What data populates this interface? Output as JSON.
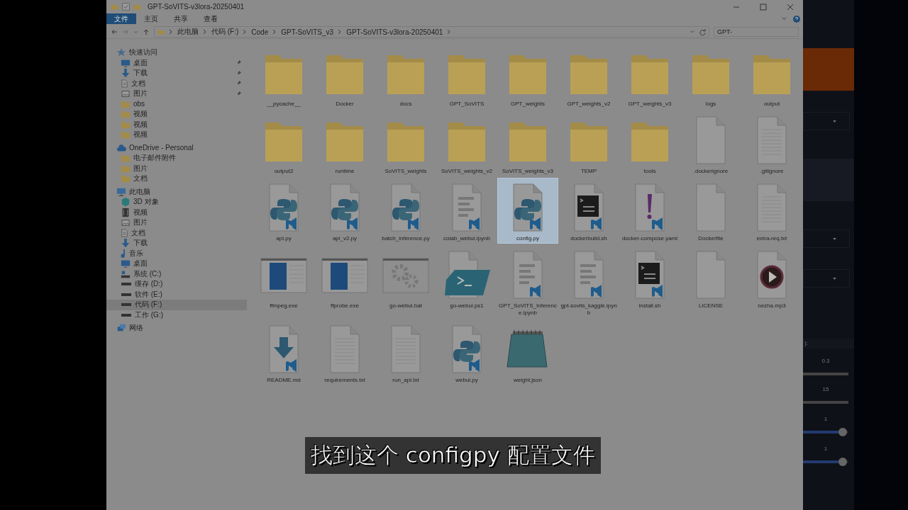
{
  "window": {
    "title": "GPT-SoVITS-v3lora-20250401"
  },
  "ribbon_tabs": [
    {
      "label": "文件",
      "selected": true
    },
    {
      "label": "主页",
      "selected": false
    },
    {
      "label": "共享",
      "selected": false
    },
    {
      "label": "查看",
      "selected": false
    }
  ],
  "address_bar": {
    "breadcrumbs": [
      "此电脑",
      "代码 (F:)",
      "Code",
      "GPT-SoVITS_v3",
      "GPT-SoVITS-v3lora-20250401"
    ],
    "search": {
      "placeholder": "GPT-"
    }
  },
  "nav": [
    {
      "kind": "star",
      "label": "快速访问",
      "selected": false,
      "children": [
        {
          "kind": "desktop",
          "label": "桌面",
          "selected": false,
          "pinned": true
        },
        {
          "kind": "download",
          "label": "下载",
          "selected": false,
          "pinned": true
        },
        {
          "kind": "document",
          "label": "文档",
          "selected": false,
          "pinned": true
        },
        {
          "kind": "picture",
          "label": "图片",
          "selected": false,
          "pinned": true
        },
        {
          "kind": "folder",
          "label": "obs",
          "selected": false,
          "pinned": false
        },
        {
          "kind": "folder",
          "label": "视频",
          "selected": false,
          "pinned": false
        },
        {
          "kind": "folder",
          "label": "视频",
          "selected": false,
          "pinned": false
        },
        {
          "kind": "folder",
          "label": "视频",
          "selected": false,
          "pinned": false
        }
      ]
    },
    {
      "kind": "cloud",
      "label": "OneDrive - Personal",
      "selected": false,
      "children": [
        {
          "kind": "folder",
          "label": "电子邮件附件",
          "selected": false
        },
        {
          "kind": "folder",
          "label": "图片",
          "selected": false
        },
        {
          "kind": "folder",
          "label": "文档",
          "selected": false
        }
      ]
    },
    {
      "kind": "computer",
      "label": "此电脑",
      "selected": false,
      "children": [
        {
          "kind": "cube",
          "label": "3D 对象",
          "selected": false
        },
        {
          "kind": "video",
          "label": "视频",
          "selected": false
        },
        {
          "kind": "picture",
          "label": "图片",
          "selected": false
        },
        {
          "kind": "document",
          "label": "文档",
          "selected": false
        },
        {
          "kind": "download",
          "label": "下载",
          "selected": false
        },
        {
          "kind": "music",
          "label": "音乐",
          "selected": false
        },
        {
          "kind": "desktop",
          "label": "桌面",
          "selected": false
        },
        {
          "kind": "system-drive",
          "label": "系统 (C:)",
          "selected": false
        },
        {
          "kind": "drive",
          "label": "缓存 (D:)",
          "selected": false
        },
        {
          "kind": "drive",
          "label": "软件 (E:)",
          "selected": false
        },
        {
          "kind": "drive",
          "label": "代码 (F:)",
          "selected": true
        },
        {
          "kind": "drive",
          "label": "工作 (G:)",
          "selected": false
        }
      ]
    },
    {
      "kind": "network",
      "label": "网络",
      "selected": false
    }
  ],
  "files": [
    {
      "kind": "folder",
      "name": "__pycache__",
      "selected": false
    },
    {
      "kind": "folder",
      "name": "Docker",
      "selected": false
    },
    {
      "kind": "folder",
      "name": "docs",
      "selected": false
    },
    {
      "kind": "folder",
      "name": "GPT_SoVITS",
      "selected": false
    },
    {
      "kind": "folder",
      "name": "GPT_weights",
      "selected": false
    },
    {
      "kind": "folder",
      "name": "GPT_weights_v2",
      "selected": false
    },
    {
      "kind": "folder",
      "name": "GPT_weights_v3",
      "selected": false
    },
    {
      "kind": "folder",
      "name": "logs",
      "selected": false
    },
    {
      "kind": "folder",
      "name": "output",
      "selected": false
    },
    {
      "kind": "folder",
      "name": "output2",
      "selected": false
    },
    {
      "kind": "folder",
      "name": "runtime",
      "selected": false
    },
    {
      "kind": "folder",
      "name": "SoVITS_weights",
      "selected": false
    },
    {
      "kind": "folder",
      "name": "SoVITS_weights_v2",
      "selected": false
    },
    {
      "kind": "folder",
      "name": "SoVITS_weights_v3",
      "selected": false
    },
    {
      "kind": "folder",
      "name": "TEMP",
      "selected": false
    },
    {
      "kind": "folder",
      "name": "tools",
      "selected": false
    },
    {
      "kind": "blank",
      "name": ".dockerignore",
      "selected": false
    },
    {
      "kind": "text",
      "name": ".gitignore",
      "selected": false
    },
    {
      "kind": "python",
      "name": "api.py",
      "selected": false
    },
    {
      "kind": "python",
      "name": "api_v2.py",
      "selected": false
    },
    {
      "kind": "python",
      "name": "batch_inference.py",
      "selected": false
    },
    {
      "kind": "notebook",
      "name": "colab_webui.ipynb",
      "selected": false
    },
    {
      "kind": "python",
      "name": "config.py",
      "selected": true
    },
    {
      "kind": "terminal",
      "name": "dockerbuild.sh",
      "selected": false
    },
    {
      "kind": "yaml",
      "name": "docker-compose.yaml",
      "selected": false
    },
    {
      "kind": "blank",
      "name": "Dockerfile",
      "selected": false
    },
    {
      "kind": "text",
      "name": "extra-req.txt",
      "selected": false
    },
    {
      "kind": "exe",
      "name": "ffmpeg.exe",
      "selected": false
    },
    {
      "kind": "exe",
      "name": "ffprobe.exe",
      "selected": false
    },
    {
      "kind": "bat",
      "name": "go-webui.bat",
      "selected": false
    },
    {
      "kind": "ps1",
      "name": "go-webui.ps1",
      "selected": false
    },
    {
      "kind": "notebook",
      "name": "GPT_SoVITS_Inference.ipynb",
      "selected": false
    },
    {
      "kind": "notebook",
      "name": "gpt-sovits_kaggle.ipynb",
      "selected": false
    },
    {
      "kind": "terminal",
      "name": "install.sh",
      "selected": false
    },
    {
      "kind": "blank",
      "name": "LICENSE",
      "selected": false
    },
    {
      "kind": "audio",
      "name": "nezha.mp3",
      "selected": false
    },
    {
      "kind": "markdown",
      "name": "README.md",
      "selected": false
    },
    {
      "kind": "text",
      "name": "requirements.txt",
      "selected": false
    },
    {
      "kind": "text",
      "name": "run_api.txt",
      "selected": false
    },
    {
      "kind": "python",
      "name": "webui.py",
      "selected": false
    },
    {
      "kind": "notepad",
      "name": "weight.json",
      "selected": false
    }
  ],
  "side_app": {
    "label_fragment": "):",
    "sliders": [
      {
        "reading": "0.3"
      },
      {
        "reading": "15"
      },
      {
        "reading": "1",
        "level": 0.88
      },
      {
        "reading": "1",
        "level": 0.88
      }
    ]
  },
  "subtitle": "找到这个 configpy 配置文件"
}
